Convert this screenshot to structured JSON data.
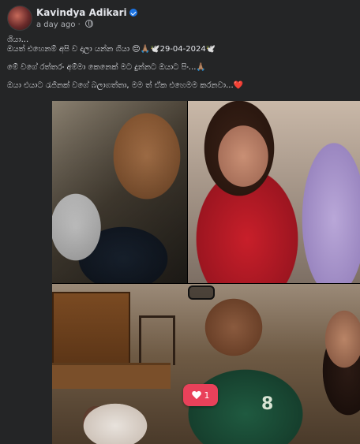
{
  "post": {
    "author": "Kavindya Adikari",
    "timestamp": "a day ago",
    "timestamp_separator": "·",
    "verified_icon": "verified-badge-icon",
    "privacy_icon": "globe-icon",
    "lines": [
      "ශියා...",
      "ඔයත් එහෙනම් අපි ව දාලා යන්න ගියා 😔🙏🏽🕊️29-04-2024🕊️",
      "මේ වගේ රත්තරං අම්මා කෙනෙක් මට දුන්නට ඔයාට පිං...🙏🏽",
      "ඔයා එයාට රැජිනක් වගේ බලාගත්තා, මම ත් ඒක එහෙමම කරනවා...❤️"
    ]
  },
  "photos": {
    "reaction": {
      "icon": "heart-icon",
      "count": "1",
      "color": "#e9415a"
    }
  },
  "colors": {
    "background": "#18191a",
    "card": "#242526",
    "text_primary": "#e4e6eb",
    "text_secondary": "#b0b3b8",
    "verified": "#1b74e4"
  }
}
